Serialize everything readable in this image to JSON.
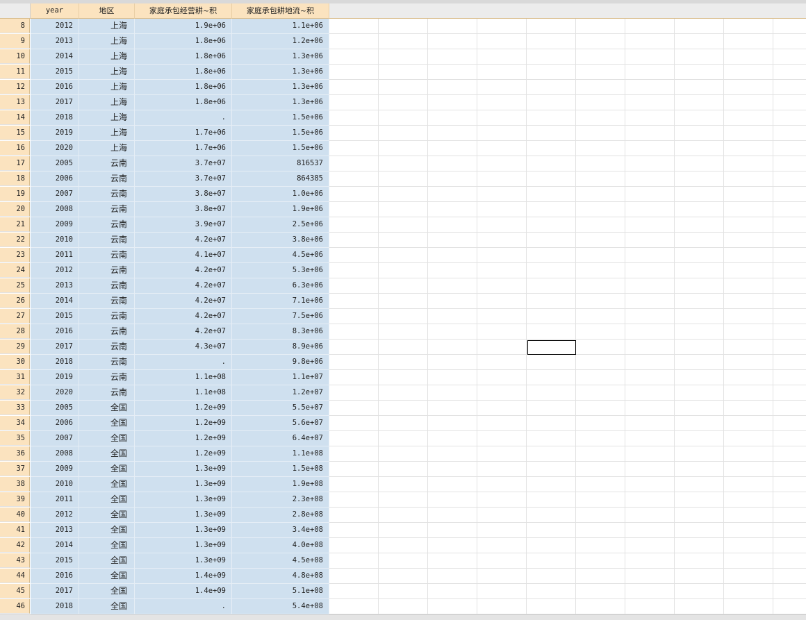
{
  "columns": {
    "year": "year",
    "region": "地区",
    "v1": "家庭承包经营耕~积",
    "v2": "家庭承包耕地流~积"
  },
  "rows": [
    {
      "n": "8",
      "year": "2012",
      "region": "上海",
      "v1": "1.9e+06",
      "v2": "1.1e+06"
    },
    {
      "n": "9",
      "year": "2013",
      "region": "上海",
      "v1": "1.8e+06",
      "v2": "1.2e+06"
    },
    {
      "n": "10",
      "year": "2014",
      "region": "上海",
      "v1": "1.8e+06",
      "v2": "1.3e+06"
    },
    {
      "n": "11",
      "year": "2015",
      "region": "上海",
      "v1": "1.8e+06",
      "v2": "1.3e+06"
    },
    {
      "n": "12",
      "year": "2016",
      "region": "上海",
      "v1": "1.8e+06",
      "v2": "1.3e+06"
    },
    {
      "n": "13",
      "year": "2017",
      "region": "上海",
      "v1": "1.8e+06",
      "v2": "1.3e+06"
    },
    {
      "n": "14",
      "year": "2018",
      "region": "上海",
      "v1": ".",
      "v2": "1.5e+06"
    },
    {
      "n": "15",
      "year": "2019",
      "region": "上海",
      "v1": "1.7e+06",
      "v2": "1.5e+06"
    },
    {
      "n": "16",
      "year": "2020",
      "region": "上海",
      "v1": "1.7e+06",
      "v2": "1.5e+06"
    },
    {
      "n": "17",
      "year": "2005",
      "region": "云南",
      "v1": "3.7e+07",
      "v2": "816537"
    },
    {
      "n": "18",
      "year": "2006",
      "region": "云南",
      "v1": "3.7e+07",
      "v2": "864385"
    },
    {
      "n": "19",
      "year": "2007",
      "region": "云南",
      "v1": "3.8e+07",
      "v2": "1.0e+06"
    },
    {
      "n": "20",
      "year": "2008",
      "region": "云南",
      "v1": "3.8e+07",
      "v2": "1.9e+06"
    },
    {
      "n": "21",
      "year": "2009",
      "region": "云南",
      "v1": "3.9e+07",
      "v2": "2.5e+06"
    },
    {
      "n": "22",
      "year": "2010",
      "region": "云南",
      "v1": "4.2e+07",
      "v2": "3.8e+06"
    },
    {
      "n": "23",
      "year": "2011",
      "region": "云南",
      "v1": "4.1e+07",
      "v2": "4.5e+06"
    },
    {
      "n": "24",
      "year": "2012",
      "region": "云南",
      "v1": "4.2e+07",
      "v2": "5.3e+06"
    },
    {
      "n": "25",
      "year": "2013",
      "region": "云南",
      "v1": "4.2e+07",
      "v2": "6.3e+06"
    },
    {
      "n": "26",
      "year": "2014",
      "region": "云南",
      "v1": "4.2e+07",
      "v2": "7.1e+06"
    },
    {
      "n": "27",
      "year": "2015",
      "region": "云南",
      "v1": "4.2e+07",
      "v2": "7.5e+06"
    },
    {
      "n": "28",
      "year": "2016",
      "region": "云南",
      "v1": "4.2e+07",
      "v2": "8.3e+06"
    },
    {
      "n": "29",
      "year": "2017",
      "region": "云南",
      "v1": "4.3e+07",
      "v2": "8.9e+06"
    },
    {
      "n": "30",
      "year": "2018",
      "region": "云南",
      "v1": ".",
      "v2": "9.8e+06"
    },
    {
      "n": "31",
      "year": "2019",
      "region": "云南",
      "v1": "1.1e+08",
      "v2": "1.1e+07"
    },
    {
      "n": "32",
      "year": "2020",
      "region": "云南",
      "v1": "1.1e+08",
      "v2": "1.2e+07"
    },
    {
      "n": "33",
      "year": "2005",
      "region": "全国",
      "v1": "1.2e+09",
      "v2": "5.5e+07"
    },
    {
      "n": "34",
      "year": "2006",
      "region": "全国",
      "v1": "1.2e+09",
      "v2": "5.6e+07"
    },
    {
      "n": "35",
      "year": "2007",
      "region": "全国",
      "v1": "1.2e+09",
      "v2": "6.4e+07"
    },
    {
      "n": "36",
      "year": "2008",
      "region": "全国",
      "v1": "1.2e+09",
      "v2": "1.1e+08"
    },
    {
      "n": "37",
      "year": "2009",
      "region": "全国",
      "v1": "1.3e+09",
      "v2": "1.5e+08"
    },
    {
      "n": "38",
      "year": "2010",
      "region": "全国",
      "v1": "1.3e+09",
      "v2": "1.9e+08"
    },
    {
      "n": "39",
      "year": "2011",
      "region": "全国",
      "v1": "1.3e+09",
      "v2": "2.3e+08"
    },
    {
      "n": "40",
      "year": "2012",
      "region": "全国",
      "v1": "1.3e+09",
      "v2": "2.8e+08"
    },
    {
      "n": "41",
      "year": "2013",
      "region": "全国",
      "v1": "1.3e+09",
      "v2": "3.4e+08"
    },
    {
      "n": "42",
      "year": "2014",
      "region": "全国",
      "v1": "1.3e+09",
      "v2": "4.0e+08"
    },
    {
      "n": "43",
      "year": "2015",
      "region": "全国",
      "v1": "1.3e+09",
      "v2": "4.5e+08"
    },
    {
      "n": "44",
      "year": "2016",
      "region": "全国",
      "v1": "1.4e+09",
      "v2": "4.8e+08"
    },
    {
      "n": "45",
      "year": "2017",
      "region": "全国",
      "v1": "1.4e+09",
      "v2": "5.1e+08"
    },
    {
      "n": "46",
      "year": "2018",
      "region": "全国",
      "v1": ".",
      "v2": "5.4e+08"
    }
  ],
  "colors": {
    "header_bg": "#fbe3bf",
    "data_bg": "#cfe0ef",
    "grid_line": "#e2e2e2"
  }
}
